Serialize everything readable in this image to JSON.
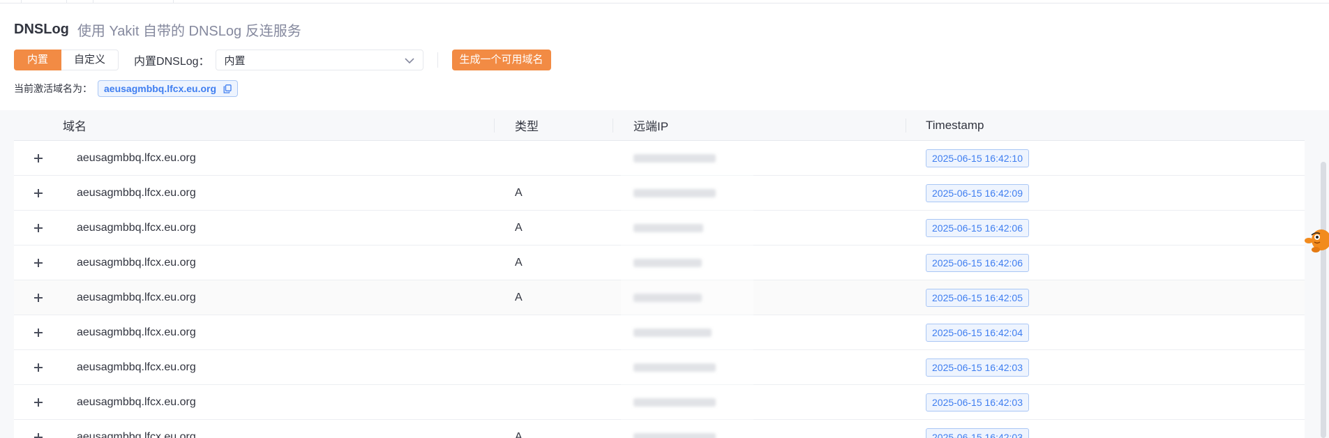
{
  "header": {
    "title": "DNSLog",
    "subtitle": "使用 Yakit 自带的 DNSLog 反连服务"
  },
  "controls": {
    "mode_builtin": "内置",
    "mode_custom": "自定义",
    "dnslog_label": "内置DNSLog：",
    "dnslog_value": "内置",
    "generate_button": "生成一个可用域名"
  },
  "active_domain": {
    "label": "当前激活域名为：",
    "value": "aeusagmbbq.lfcx.eu.org"
  },
  "table": {
    "columns": [
      "域名",
      "类型",
      "远端IP",
      "Timestamp"
    ],
    "rows": [
      {
        "domain": "aeusagmbbq.lfcx.eu.org",
        "type": "",
        "timestamp": "2025-06-15 16:42:10"
      },
      {
        "domain": "aeusagmbbq.lfcx.eu.org",
        "type": "A",
        "timestamp": "2025-06-15 16:42:09"
      },
      {
        "domain": "aeusagmbbq.lfcx.eu.org",
        "type": "A",
        "timestamp": "2025-06-15 16:42:06"
      },
      {
        "domain": "aeusagmbbq.lfcx.eu.org",
        "type": "A",
        "timestamp": "2025-06-15 16:42:06"
      },
      {
        "domain": "aeusagmbbq.lfcx.eu.org",
        "type": "A",
        "timestamp": "2025-06-15 16:42:05"
      },
      {
        "domain": "aeusagmbbq.lfcx.eu.org",
        "type": "",
        "timestamp": "2025-06-15 16:42:04"
      },
      {
        "domain": "aeusagmbbq.lfcx.eu.org",
        "type": "",
        "timestamp": "2025-06-15 16:42:03"
      },
      {
        "domain": "aeusagmbbq.lfcx.eu.org",
        "type": "",
        "timestamp": "2025-06-15 16:42:03"
      },
      {
        "domain": "aeusagmbbq.lfcx.eu.org",
        "type": "A",
        "timestamp": "2025-06-15 16:42:03"
      }
    ]
  },
  "colors": {
    "accent": "#f28b44",
    "tag_blue": "#3f7ef0",
    "tag_bg": "#eef4fe"
  },
  "icons": [
    "chevron-down-icon",
    "copy-icon",
    "expand-plus-icon",
    "mascot-icon"
  ]
}
